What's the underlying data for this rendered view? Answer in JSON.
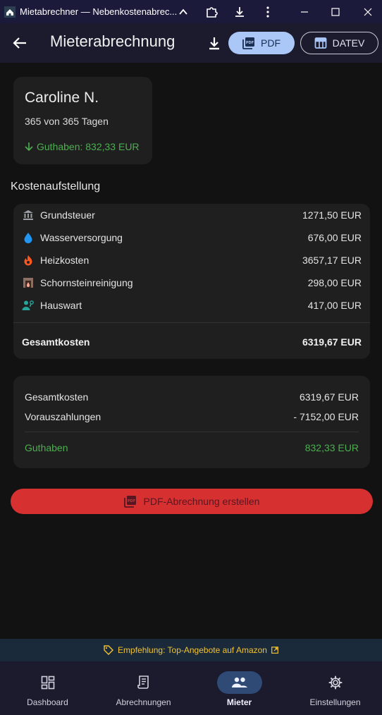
{
  "window": {
    "title": "Mietabrechner — Nebenkostenabrec..."
  },
  "appbar": {
    "title": "Mieterabrechnung",
    "pdf_label": "PDF",
    "datev_label": "DATEV"
  },
  "tenant": {
    "name": "Caroline N.",
    "days": "365 von 365 Tagen",
    "credit": "Guthaben: 832,33 EUR"
  },
  "costs": {
    "section_title": "Kostenaufstellung",
    "items": [
      {
        "icon": "bank-icon",
        "label": "Grundsteuer",
        "amount": "1271,50 EUR",
        "color": "#9aa0a6"
      },
      {
        "icon": "water-drop-icon",
        "label": "Wasserversorgung",
        "amount": "676,00 EUR",
        "color": "#2196f3"
      },
      {
        "icon": "fire-icon",
        "label": "Heizkosten",
        "amount": "3657,17 EUR",
        "color": "#ff5722"
      },
      {
        "icon": "fireplace-icon",
        "label": "Schornsteinreinigung",
        "amount": "298,00 EUR",
        "color": "#8d6e63"
      },
      {
        "icon": "person-wrench-icon",
        "label": "Hauswart",
        "amount": "417,00 EUR",
        "color": "#26a69a"
      }
    ],
    "total_label": "Gesamtkosten",
    "total_amount": "6319,67 EUR"
  },
  "summary": {
    "rows": [
      {
        "label": "Gesamtkosten",
        "amount": "6319,67 EUR"
      },
      {
        "label": "Vorauszahlungen",
        "amount": "- 7152,00 EUR"
      }
    ],
    "result_label": "Guthaben",
    "result_amount": "832,33 EUR",
    "result_color": "#4caf50"
  },
  "create_button": {
    "label": "PDF-Abrechnung erstellen",
    "color": "#d63031"
  },
  "promo": {
    "text": "Empfehlung: Top-Angebote auf Amazon"
  },
  "nav": {
    "items": [
      {
        "icon": "dashboard-icon",
        "label": "Dashboard"
      },
      {
        "icon": "receipt-icon",
        "label": "Abrechnungen"
      },
      {
        "icon": "people-icon",
        "label": "Mieter",
        "active": true
      },
      {
        "icon": "gear-icon",
        "label": "Einstellungen"
      }
    ]
  }
}
